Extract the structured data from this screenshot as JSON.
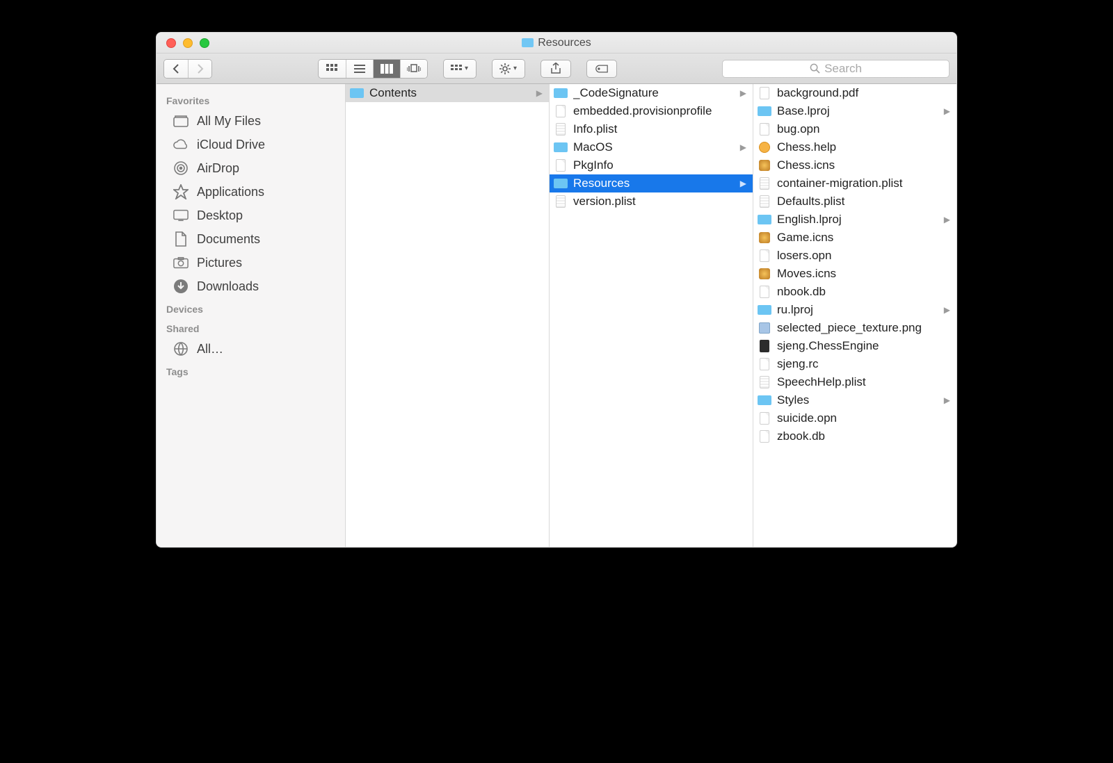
{
  "window": {
    "title": "Resources"
  },
  "search": {
    "placeholder": "Search"
  },
  "sidebar": {
    "sections": {
      "favorites": "Favorites",
      "devices": "Devices",
      "shared": "Shared",
      "tags": "Tags"
    },
    "favorites": [
      {
        "label": "All My Files",
        "icon": "all-files"
      },
      {
        "label": "iCloud Drive",
        "icon": "cloud"
      },
      {
        "label": "AirDrop",
        "icon": "airdrop"
      },
      {
        "label": "Applications",
        "icon": "apps"
      },
      {
        "label": "Desktop",
        "icon": "desktop"
      },
      {
        "label": "Documents",
        "icon": "documents"
      },
      {
        "label": "Pictures",
        "icon": "pictures"
      },
      {
        "label": "Downloads",
        "icon": "downloads"
      }
    ],
    "shared": [
      {
        "label": "All…",
        "icon": "network"
      }
    ]
  },
  "columns": [
    {
      "items": [
        {
          "label": "Contents",
          "type": "folder",
          "has_children": true,
          "selected": "path"
        }
      ]
    },
    {
      "items": [
        {
          "label": "_CodeSignature",
          "type": "folder",
          "has_children": true
        },
        {
          "label": "embedded.provisionprofile",
          "type": "doc"
        },
        {
          "label": "Info.plist",
          "type": "plist"
        },
        {
          "label": "MacOS",
          "type": "folder",
          "has_children": true
        },
        {
          "label": "PkgInfo",
          "type": "doc"
        },
        {
          "label": "Resources",
          "type": "folder",
          "has_children": true,
          "selected": "active"
        },
        {
          "label": "version.plist",
          "type": "plist"
        }
      ]
    },
    {
      "items": [
        {
          "label": "background.pdf",
          "type": "pdf"
        },
        {
          "label": "Base.lproj",
          "type": "folder",
          "has_children": true
        },
        {
          "label": "bug.opn",
          "type": "doc"
        },
        {
          "label": "Chess.help",
          "type": "help"
        },
        {
          "label": "Chess.icns",
          "type": "icns"
        },
        {
          "label": "container-migration.plist",
          "type": "plist"
        },
        {
          "label": "Defaults.plist",
          "type": "plist"
        },
        {
          "label": "English.lproj",
          "type": "folder",
          "has_children": true
        },
        {
          "label": "Game.icns",
          "type": "icns"
        },
        {
          "label": "losers.opn",
          "type": "doc"
        },
        {
          "label": "Moves.icns",
          "type": "icns"
        },
        {
          "label": "nbook.db",
          "type": "doc"
        },
        {
          "label": "ru.lproj",
          "type": "folder",
          "has_children": true
        },
        {
          "label": "selected_piece_texture.png",
          "type": "png"
        },
        {
          "label": "sjeng.ChessEngine",
          "type": "exec"
        },
        {
          "label": "sjeng.rc",
          "type": "doc"
        },
        {
          "label": "SpeechHelp.plist",
          "type": "plist"
        },
        {
          "label": "Styles",
          "type": "folder",
          "has_children": true
        },
        {
          "label": "suicide.opn",
          "type": "doc"
        },
        {
          "label": "zbook.db",
          "type": "doc"
        }
      ]
    }
  ]
}
